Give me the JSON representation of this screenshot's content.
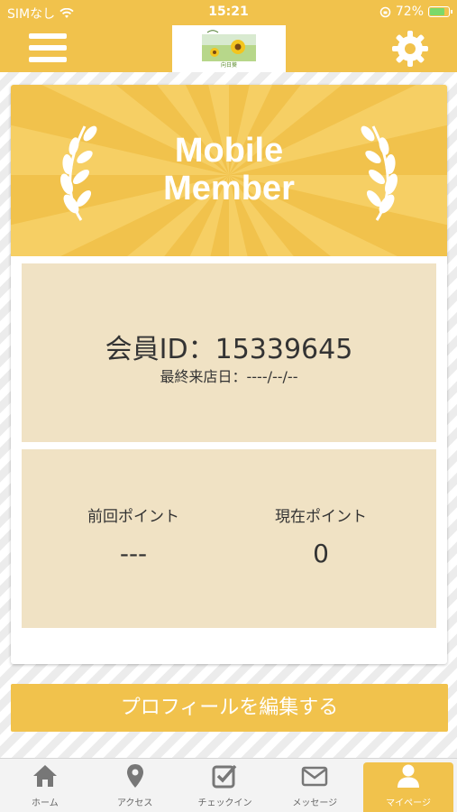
{
  "status_bar": {
    "carrier": "SIMなし",
    "time": "15:21",
    "battery": "72%"
  },
  "header": {
    "menu_icon": "hamburger-icon",
    "settings_icon": "gear-icon",
    "logo_text": "向日葵"
  },
  "banner": {
    "title_line1": "Mobile",
    "title_line2": "Member"
  },
  "member": {
    "id_text": "会員ID：15339645",
    "last_visit_text": "最終来店日：----/--/--"
  },
  "points": {
    "previous_label": "前回ポイント",
    "previous_value": "---",
    "current_label": "現在ポイント",
    "current_value": "0"
  },
  "edit_profile_label": "プロフィールを編集する",
  "tabs": [
    {
      "label": "ホーム",
      "icon": "home-icon"
    },
    {
      "label": "アクセス",
      "icon": "location-pin-icon"
    },
    {
      "label": "チェックイン",
      "icon": "checkbox-icon"
    },
    {
      "label": "メッセージ",
      "icon": "envelope-icon"
    },
    {
      "label": "マイページ",
      "icon": "user-icon"
    }
  ],
  "colors": {
    "accent": "#f1c24c",
    "panel": "#f0e2c4",
    "text": "#333333"
  }
}
